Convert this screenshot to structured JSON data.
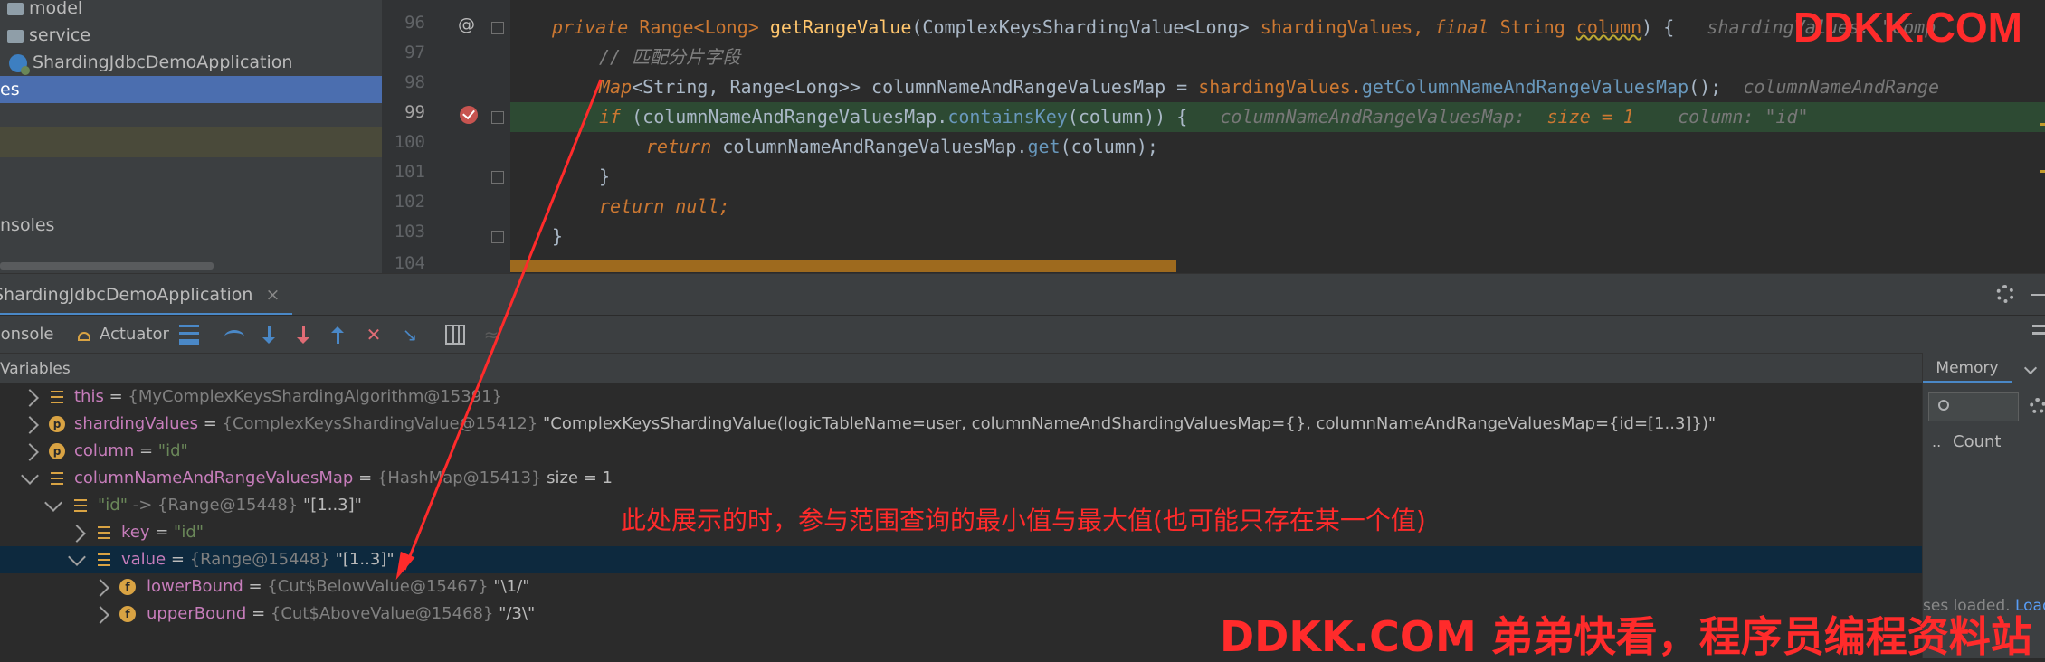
{
  "project_tree": {
    "items": [
      {
        "label": "model",
        "icon": "folder-icon"
      },
      {
        "label": "service",
        "icon": "folder-icon"
      },
      {
        "label": "ShardingJdbcDemoApplication",
        "icon": "spring-app-icon"
      },
      {
        "label": "es",
        "selected": true
      },
      {
        "label": ""
      },
      {
        "label": ""
      },
      {
        "label": "nsoles"
      }
    ]
  },
  "editor": {
    "line_numbers": [
      "96",
      "97",
      "98",
      "99",
      "100",
      "101",
      "102",
      "103",
      "104"
    ],
    "lines": {
      "l96": {
        "modifier": "private ",
        "type": "Range<Long> ",
        "method": "getRangeValue",
        "params_a": "(ComplexKeysShardingValue<Long> ",
        "param1": "shardingValues, ",
        "final_kw": "final ",
        "param2_type": "String ",
        "param2": "column",
        "params_b": ") {",
        "hint": "shardingValues: \"Comp"
      },
      "l97": {
        "comment": "// 匹配分片字段"
      },
      "l98": {
        "type": "Map",
        "generic": "<String, Range<Long>> ",
        "var": "columnNameAndRangeValuesMap = ",
        "receiver": "shardingValues.",
        "call": "getColumnNameAndRangeValuesMap",
        "end": "();",
        "hint": "columnNameAndRange"
      },
      "l99": {
        "kw": "if ",
        "expr_a": "(columnNameAndRangeValuesMap.",
        "call": "containsKey",
        "expr_b": "(column)) {",
        "hint1": "columnNameAndRangeValuesMap:",
        "hint1_val": "size = 1",
        "hint2": "column: \"id\""
      },
      "l100": {
        "kw": "return ",
        "expr_a": "columnNameAndRangeValuesMap.",
        "call": "get",
        "expr_b": "(column);"
      },
      "l101": {
        "text": "}"
      },
      "l102": {
        "kw": "return ",
        "val": "null;"
      },
      "l103": {
        "text": "}"
      }
    }
  },
  "watermark_top": "DDKK.COM",
  "debug": {
    "session_tab": "ShardingJdbcDemoApplication",
    "close": "×",
    "console_tab": "Console",
    "actuator_tab": "Actuator",
    "variables_title": "Variables",
    "memory_title": "Memory",
    "memory_col_dots": "..",
    "memory_col_count": "Count",
    "memory_status": "ses loaded.",
    "memory_load_link": "Load"
  },
  "variables": [
    {
      "name": "this",
      "eq": " = ",
      "type": "{MyComplexKeysShardingAlgorithm@15391}",
      "value": ""
    },
    {
      "name": "shardingValues",
      "eq": " = ",
      "type": "{ComplexKeysShardingValue@15412} ",
      "value": "\"ComplexKeysShardingValue(logicTableName=user, columnNameAndShardingValuesMap={}, columnNameAndRangeValuesMap={id=[1..3]})\""
    },
    {
      "name": "column",
      "eq": " = ",
      "type": "",
      "value": "\"id\""
    },
    {
      "name": "columnNameAndRangeValuesMap",
      "eq": " = ",
      "type": "{HashMap@15413} ",
      "value": " size = 1"
    },
    {
      "name": "\"id\"",
      "eq": " -> ",
      "type": "{Range@15448} ",
      "value": "\"[1..3]\""
    },
    {
      "name": "key",
      "eq": " = ",
      "type": "",
      "value": "\"id\""
    },
    {
      "name": "value",
      "eq": " = ",
      "type": "{Range@15448} ",
      "value": "\"[1..3]\""
    },
    {
      "name": "lowerBound",
      "eq": " = ",
      "type": "{Cut$BelowValue@15467} ",
      "value": "\"\\1/\""
    },
    {
      "name": "upperBound",
      "eq": " = ",
      "type": "{Cut$AboveValue@15468} ",
      "value": "\"/3\\\""
    }
  ],
  "annotation": "此处展示的时，参与范围查询的最小值与最大值(也可能只存在某一个值)",
  "watermark_bottom": "DDKK.COM 弟弟快看，程序员编程资料站",
  "colors": {
    "annotation_red": "#ff2b2b",
    "selection": "#0d293e",
    "breakpoint_line": "#2d4a33"
  }
}
